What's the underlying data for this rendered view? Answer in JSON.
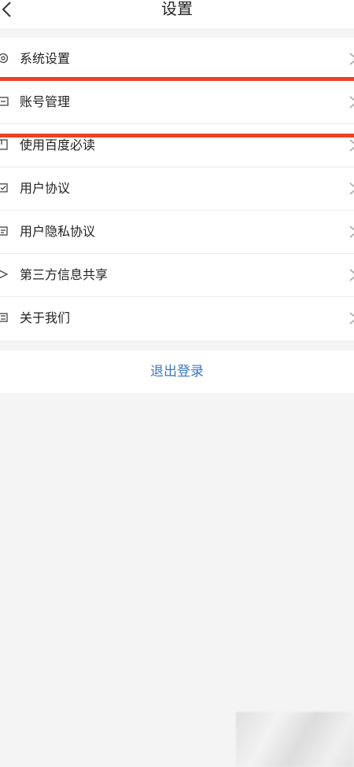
{
  "header": {
    "title": "设置"
  },
  "settings": {
    "items": [
      {
        "label": "系统设置",
        "icon": "gear-icon"
      },
      {
        "label": "账号管理",
        "icon": "account-icon"
      },
      {
        "label": "使用百度必读",
        "icon": "book-icon"
      },
      {
        "label": "用户协议",
        "icon": "agreement-icon"
      },
      {
        "label": "用户隐私协议",
        "icon": "privacy-icon"
      },
      {
        "label": "第三方信息共享",
        "icon": "share-icon"
      },
      {
        "label": "关于我们",
        "icon": "info-icon"
      }
    ]
  },
  "logout": {
    "label": "退出登录"
  },
  "colors": {
    "background": "#f4f4f4",
    "highlight": "#ea4323",
    "logout_text": "#3a78c2"
  }
}
